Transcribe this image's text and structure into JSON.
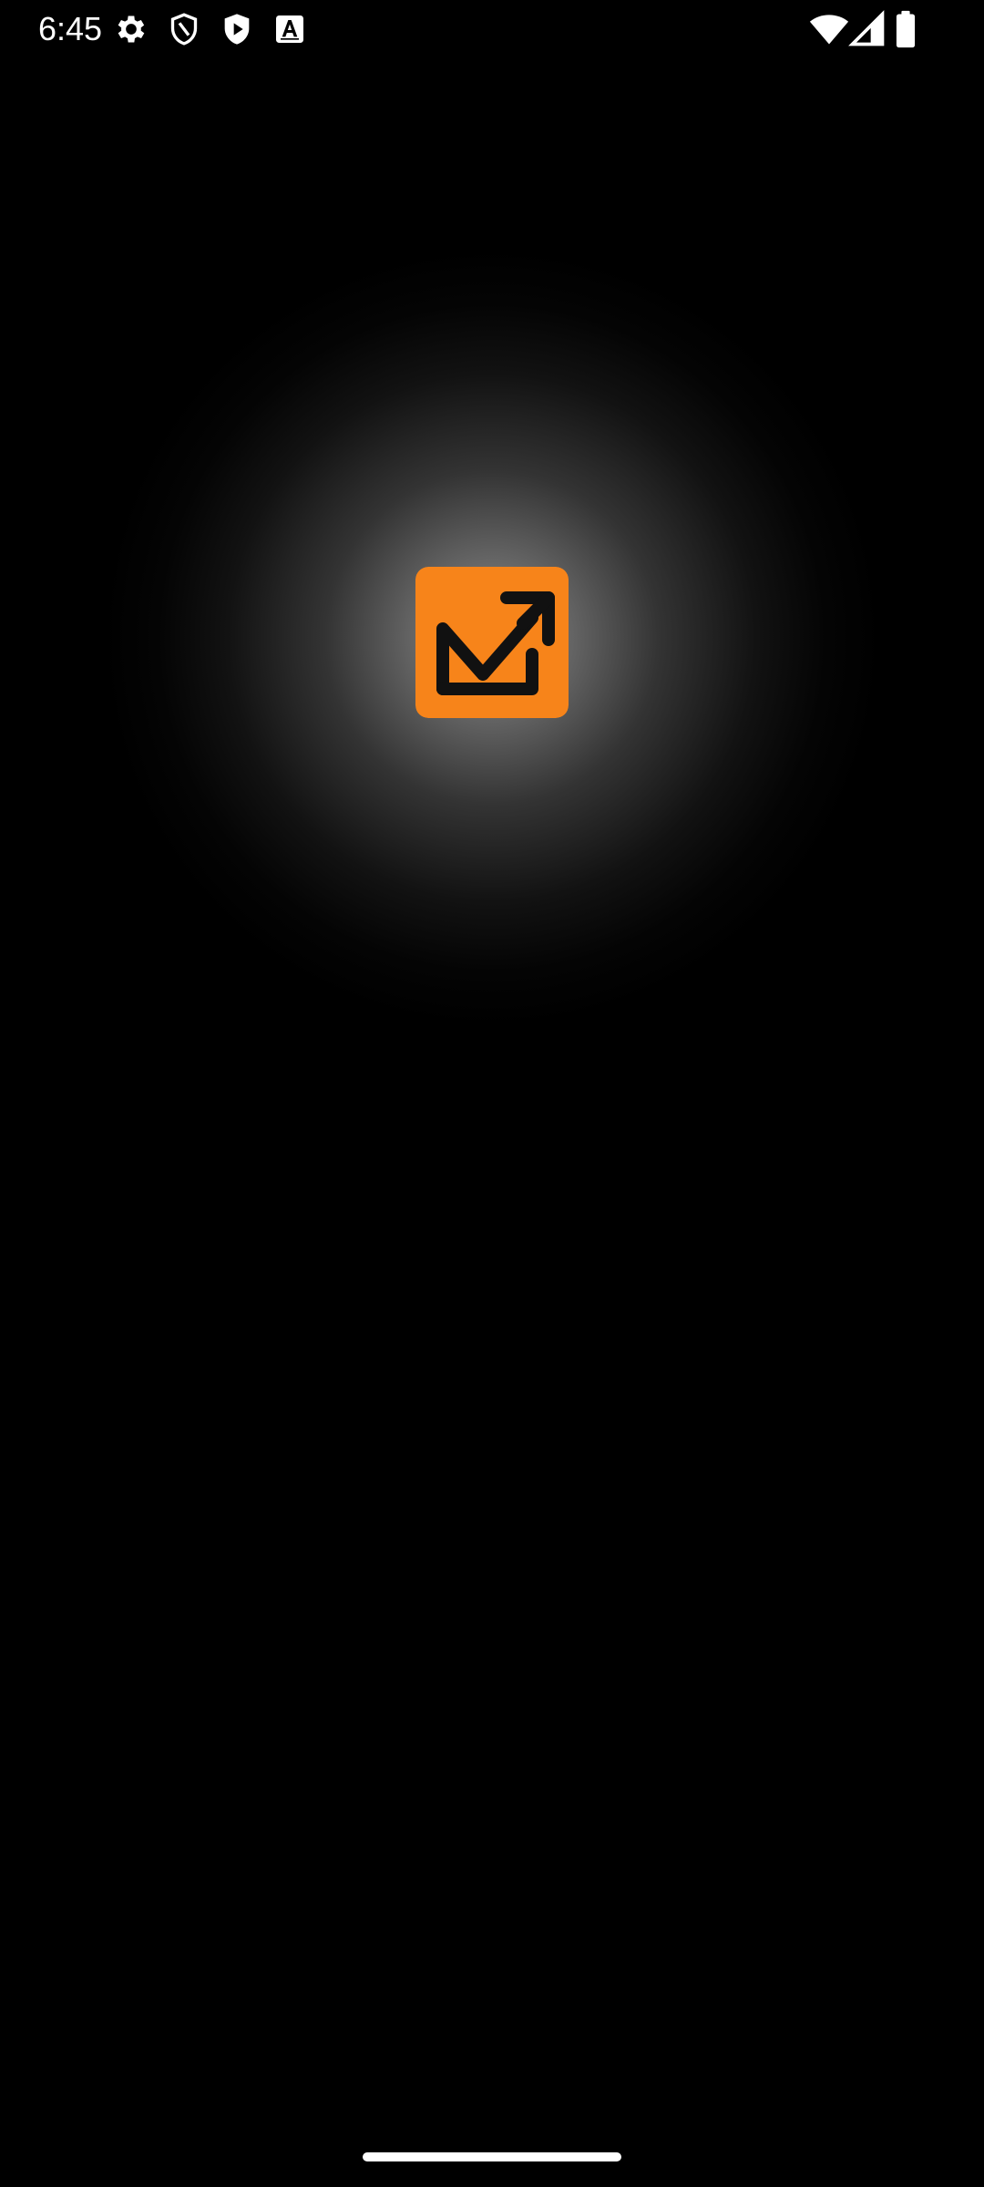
{
  "status_bar": {
    "time": "6:45",
    "left_icons": [
      "settings-icon",
      "shield-icon",
      "play-shield-icon",
      "accessibility-a-icon"
    ],
    "right_icons": [
      "wifi-icon",
      "cellular-signal-icon",
      "battery-icon"
    ]
  },
  "splash": {
    "logo_icon": "mail-send-arrow-icon",
    "logo_color": "#F7841A",
    "logo_glyph_color": "#111111",
    "background_color": "#000000",
    "glow_color": "#FFFFFF"
  },
  "nav": {
    "home_indicator_color": "#FFFFFF"
  }
}
